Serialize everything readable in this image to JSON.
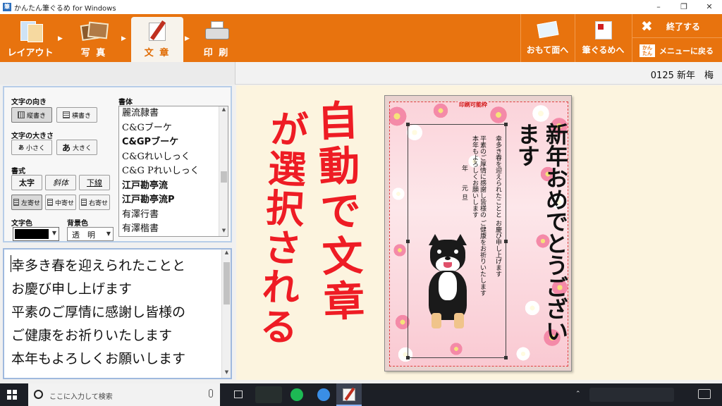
{
  "window": {
    "title": "かんたん筆ぐるめ for Windows"
  },
  "toolbar": {
    "layout": "レイアウト",
    "photo": "写 真",
    "text": "文 章",
    "print": "印 刷",
    "omote": "おもて面へ",
    "fude": "筆ぐるめへ",
    "exit": "終了する",
    "menu_badge": "かんたん",
    "menu": "メニューに戻る"
  },
  "template_name": "0125 新年　梅",
  "panel": {
    "direction_label": "文字の向き",
    "vertical": "縦書き",
    "horizontal": "横書き",
    "size_label": "文字の大きさ",
    "smaller": "小さく",
    "larger": "大きく",
    "style_label": "書式",
    "bold": "太字",
    "italic": "斜体",
    "underline": "下線",
    "align_left": "左寄せ",
    "align_center": "中寄せ",
    "align_right": "右寄せ",
    "text_color_label": "文字色",
    "bg_color_label": "背景色",
    "bg_value": "透　明",
    "font_label": "書体",
    "fonts": [
      "麗流隷書",
      "C&Gブーケ",
      "C&GPブーケ",
      "C&Gれいしっく",
      "C&G Pれいしっく",
      "江戸勘亭流",
      "江戸勘亭流P",
      "有澤行書",
      "有澤楷書"
    ]
  },
  "editor": {
    "lines": [
      "幸多き春を迎えられたことと",
      "お慶び申し上げます",
      "平素のご厚情に感謝し皆様の",
      "ご健康をお祈りいたします",
      "本年もよろしくお願いします"
    ]
  },
  "card": {
    "print_frame_label": "印刷可能枠",
    "greeting": "新年おめでとうございます",
    "body_lines": [
      "幸多き春を迎えられたことと お慶び申し上げます",
      "平素のご厚情に感謝し皆様の ご健康をお祈りいたします",
      "本年もよろしくお願いします"
    ],
    "year": "年",
    "gantan": "元旦"
  },
  "annotation": {
    "col1": "自動で文章",
    "col2": "が選択される"
  },
  "taskbar": {
    "search_placeholder": "ここに入力して検索"
  },
  "colors": {
    "accent": "#e8730e",
    "text_color": "#000000",
    "annotation": "#ee1c24"
  }
}
